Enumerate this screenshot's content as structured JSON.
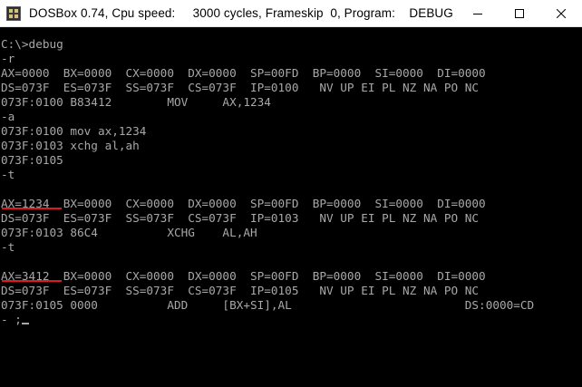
{
  "window": {
    "title": "DOSBox 0.74, Cpu speed:     3000 cycles, Frameskip  0, Program:    DEBUG"
  },
  "icons": {
    "app": "dosbox-icon",
    "minimize": "minimize-icon",
    "maximize": "maximize-icon",
    "close": "close-icon"
  },
  "console": {
    "lines": [
      "C:\\>debug",
      "-r",
      "AX=0000  BX=0000  CX=0000  DX=0000  SP=00FD  BP=0000  SI=0000  DI=0000",
      "DS=073F  ES=073F  SS=073F  CS=073F  IP=0100   NV UP EI PL NZ NA PO NC",
      "073F:0100 B83412        MOV     AX,1234",
      "-a",
      "073F:0100 mov ax,1234",
      "073F:0103 xchg al,ah",
      "073F:0105",
      "-t",
      "",
      "AX=1234  BX=0000  CX=0000  DX=0000  SP=00FD  BP=0000  SI=0000  DI=0000",
      "DS=073F  ES=073F  SS=073F  CS=073F  IP=0103   NV UP EI PL NZ NA PO NC",
      "073F:0103 86C4          XCHG    AL,AH",
      "-t",
      "",
      "AX=3412  BX=0000  CX=0000  DX=0000  SP=00FD  BP=0000  SI=0000  DI=0000",
      "DS=073F  ES=073F  SS=073F  CS=073F  IP=0105   NV UP EI PL NZ NA PO NC",
      "073F:0105 0000          ADD     [BX+SI],AL                         DS:0000=CD",
      "- ;"
    ]
  },
  "colors": {
    "console_text": "#a8a8a8",
    "console_background": "#000000",
    "annotation_underline": "#e1191c"
  }
}
